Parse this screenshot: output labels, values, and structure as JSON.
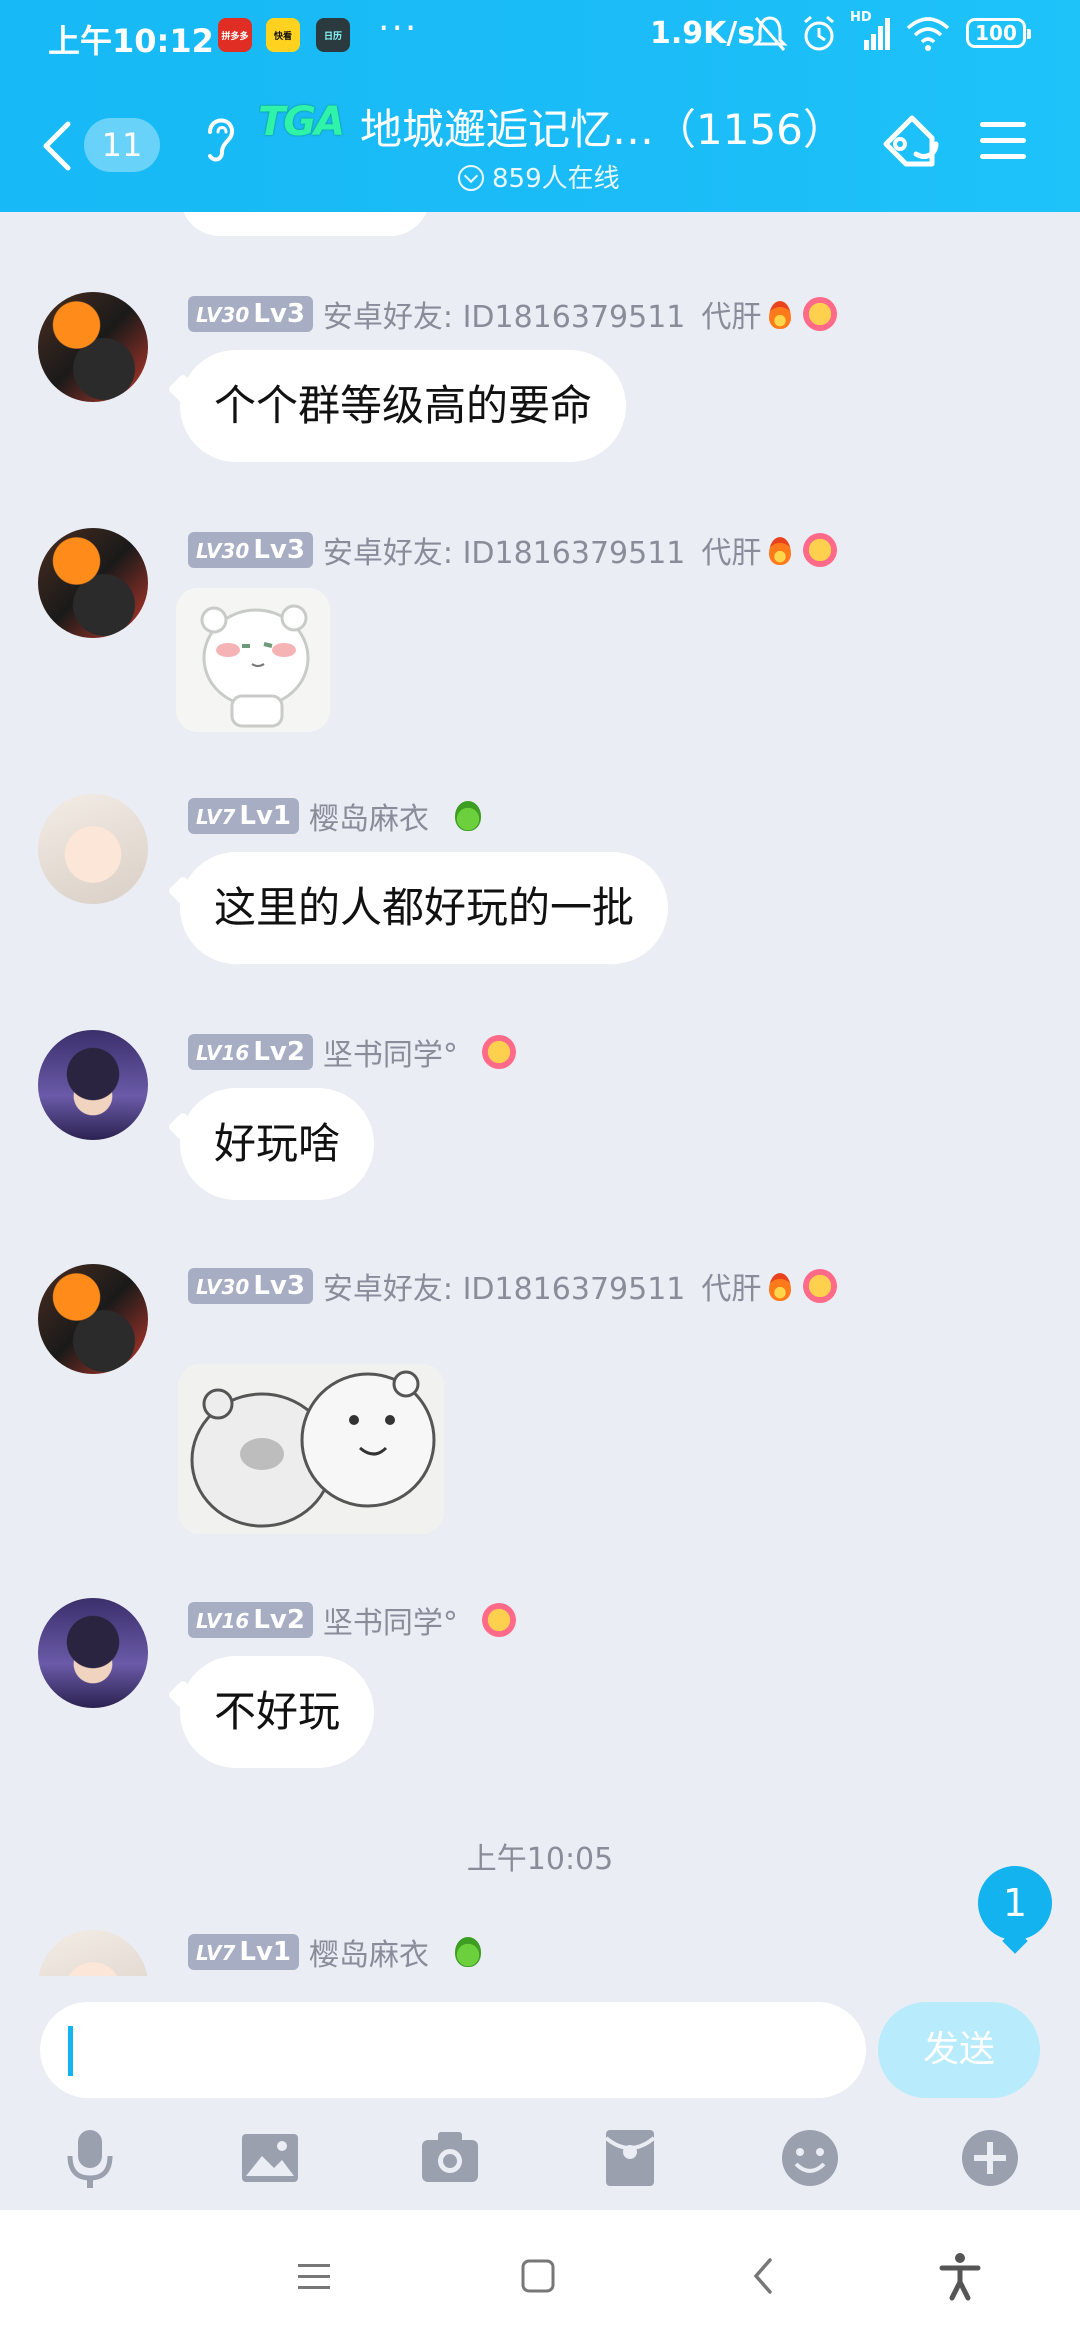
{
  "status_bar": {
    "time": "上午10:12",
    "apps": [
      "拼多多",
      "快看",
      "日历"
    ],
    "dots": "···",
    "speed": "1.9K/s",
    "signal_label": "HD",
    "battery": "100"
  },
  "header": {
    "back_count": "11",
    "logo_text": "TGA",
    "title": "地城邂逅记忆…（1156）",
    "online": "859人在线"
  },
  "messages": [
    {
      "level_tag": "LV30",
      "level": "Lv3",
      "name": "安卓好友: ID1816379511",
      "title": "代肝",
      "text": "个个群等级高的要命"
    },
    {
      "level_tag": "LV30",
      "level": "Lv3",
      "name": "安卓好友: ID1816379511",
      "title": "代肝"
    },
    {
      "level_tag": "LV7",
      "level": "Lv1",
      "name": "樱岛麻衣",
      "text": "这里的人都好玩的一批"
    },
    {
      "level_tag": "LV16",
      "level": "Lv2",
      "name": "坚书同学°",
      "text": "好玩啥"
    },
    {
      "level_tag": "LV30",
      "level": "Lv3",
      "name": "安卓好友: ID1816379511",
      "title": "代肝"
    },
    {
      "level_tag": "LV16",
      "level": "Lv2",
      "name": "坚书同学°",
      "text": "不好玩"
    },
    {
      "level_tag": "LV7",
      "level": "Lv1",
      "name": "樱岛麻衣"
    }
  ],
  "time_divider": "上午10:05",
  "new_message_count": "1",
  "input": {
    "placeholder": "",
    "send_label": "发送"
  },
  "colors": {
    "header": "#17b9f6",
    "background": "#ebedf5",
    "level_badge": "#a7adc2",
    "send_disabled": "#b8ebfb"
  },
  "toolbar_icons": [
    "microphone-icon",
    "image-icon",
    "camera-icon",
    "red-packet-icon",
    "emoji-icon",
    "plus-icon"
  ],
  "system_nav_icons": [
    "menu-icon",
    "home-icon",
    "back-icon",
    "accessibility-icon"
  ]
}
